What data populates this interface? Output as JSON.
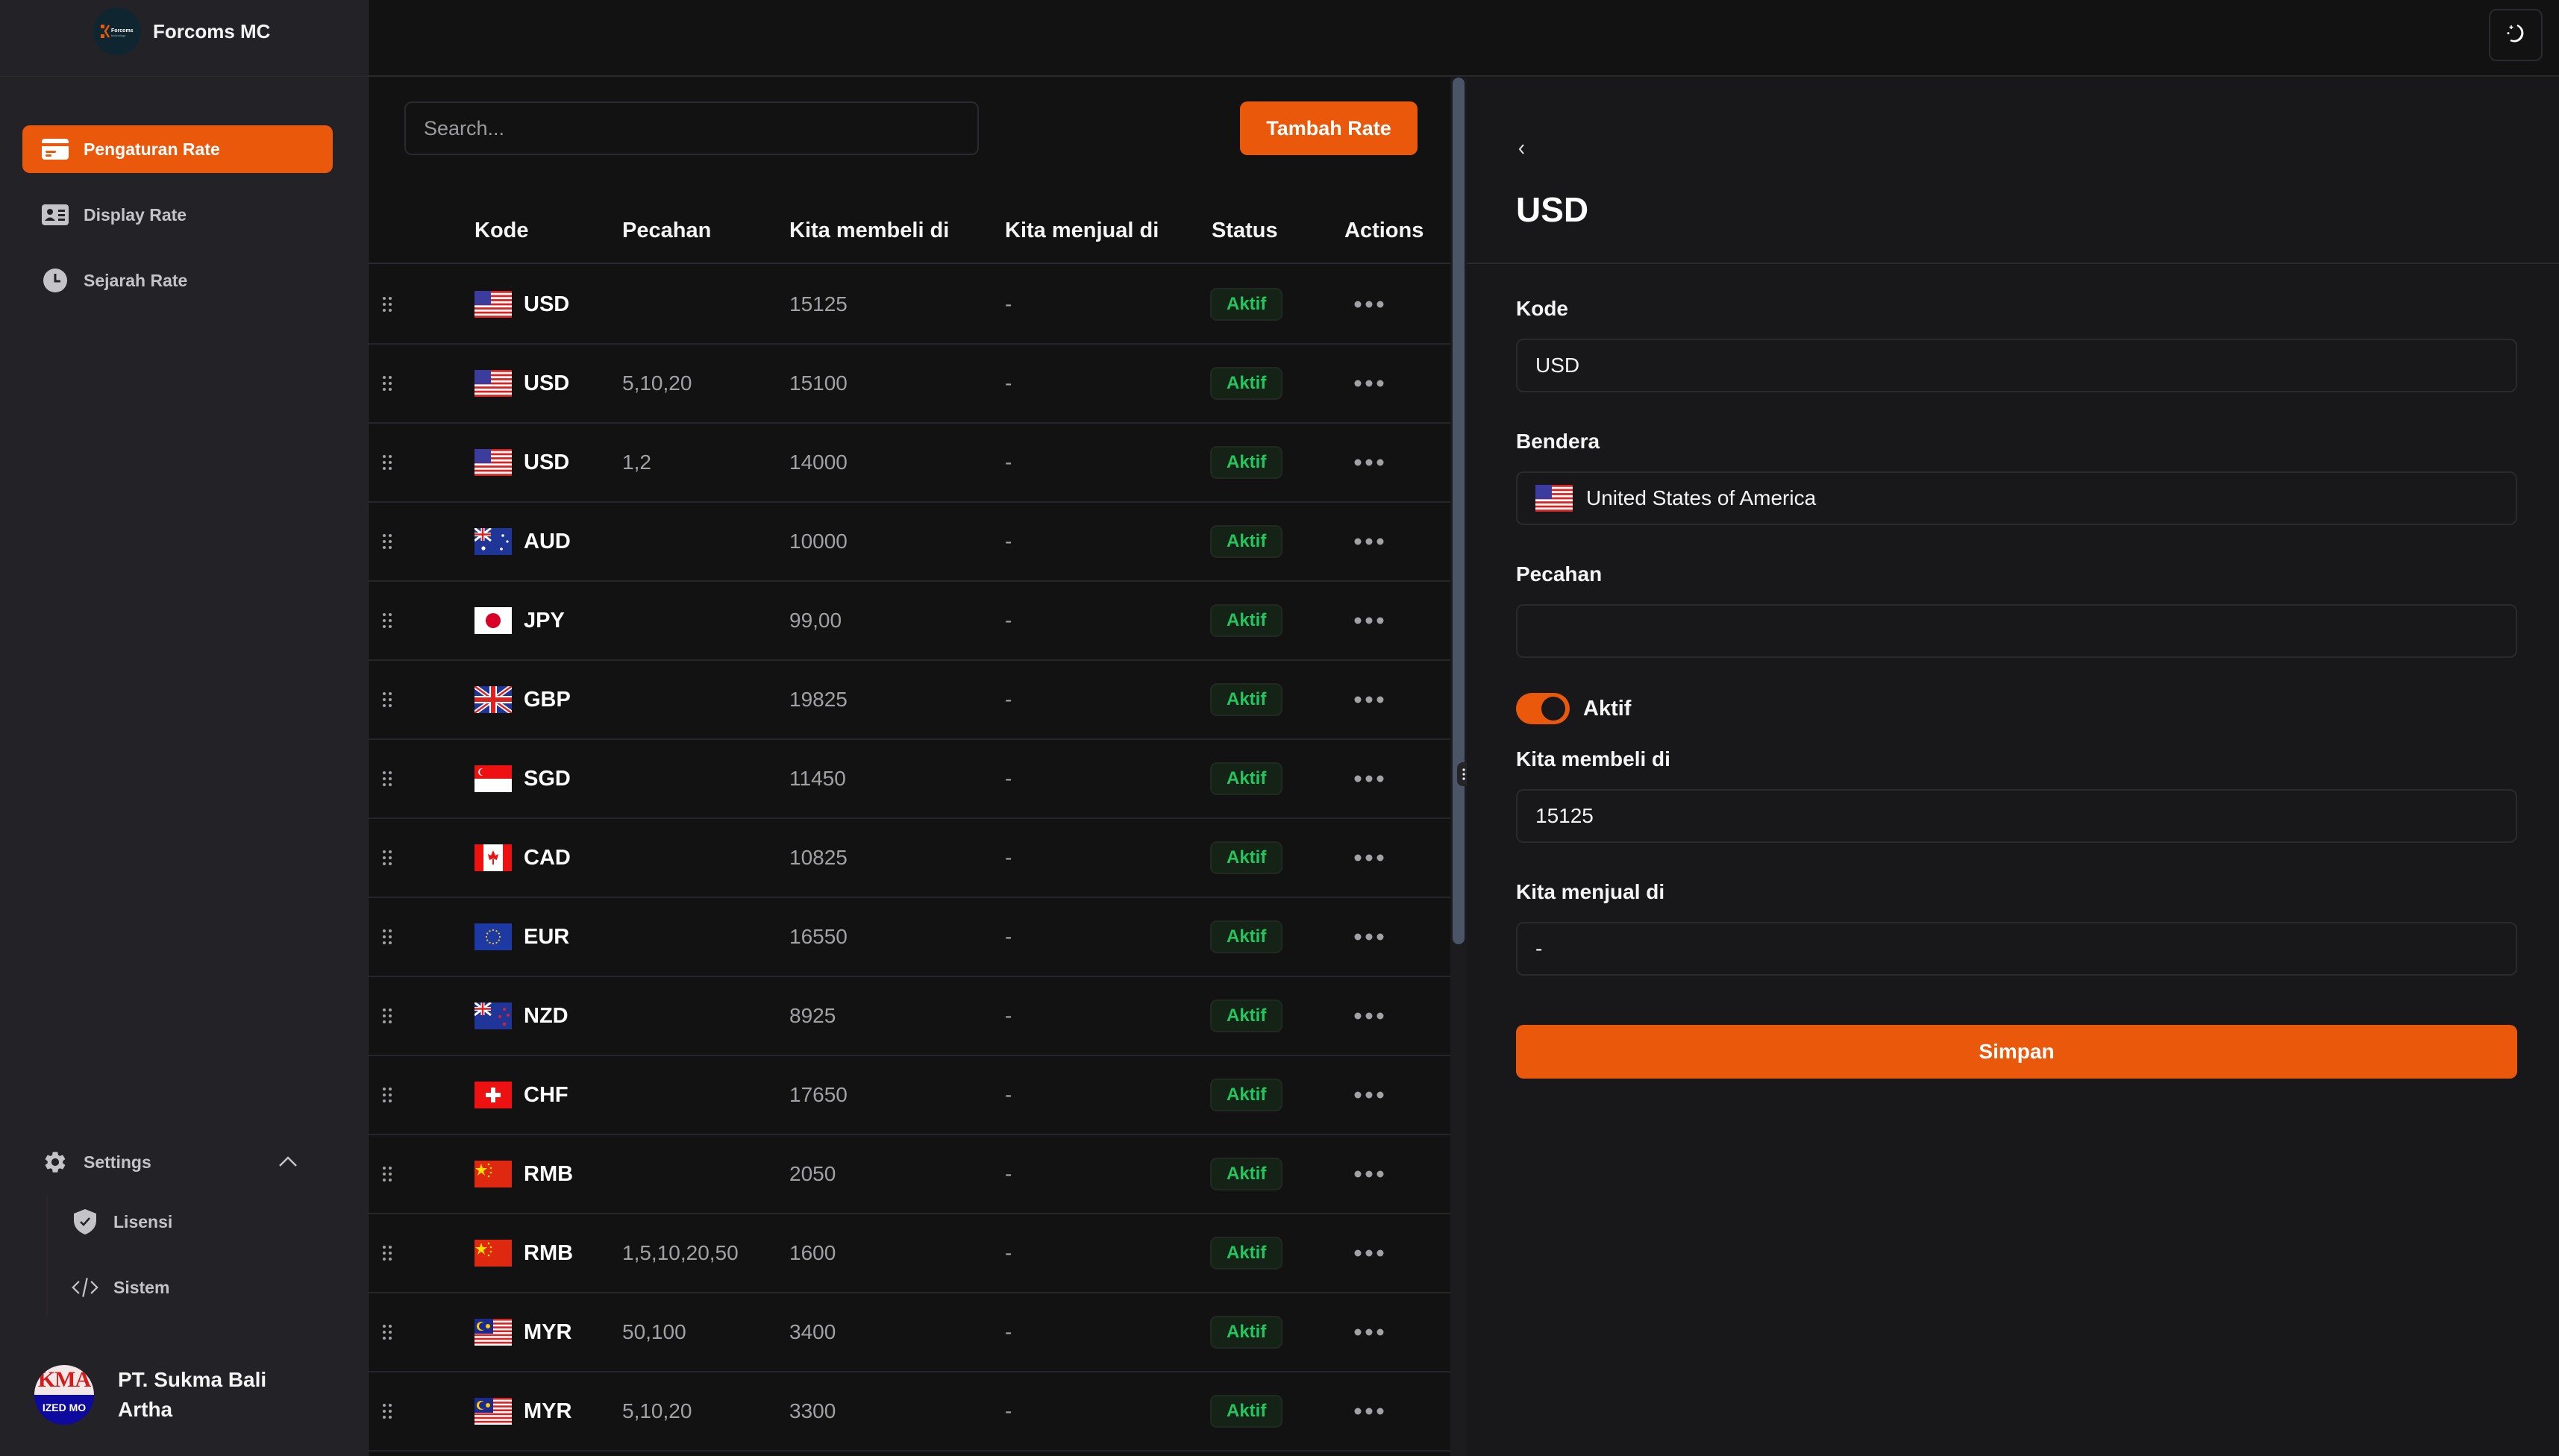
{
  "app": {
    "name": "Forcoms MC",
    "logo_text": "Forcoms"
  },
  "sidebar": {
    "items": [
      {
        "label": "Pengaturan Rate",
        "icon": "credit-card-icon",
        "active": true
      },
      {
        "label": "Display Rate",
        "icon": "id-card-icon",
        "active": false
      },
      {
        "label": "Sejarah Rate",
        "icon": "clock-icon",
        "active": false
      }
    ],
    "settings": {
      "label": "Settings",
      "icon": "gear-icon",
      "expanded": true,
      "items": [
        {
          "label": "Lisensi",
          "icon": "shield-check-icon"
        },
        {
          "label": "Sistem",
          "icon": "code-icon"
        }
      ]
    },
    "org": {
      "name": "PT. Sukma Bali Artha",
      "avatar_top": "KMA",
      "avatar_bottom": "IZED MO"
    }
  },
  "topbar": {
    "theme_icon": "moon-stars-icon"
  },
  "table": {
    "search_placeholder": "Search...",
    "add_label": "Tambah Rate",
    "headers": {
      "kode": "Kode",
      "pecahan": "Pecahan",
      "beli": "Kita membeli di",
      "jual": "Kita menjual di",
      "status": "Status",
      "actions": "Actions"
    },
    "rows": [
      {
        "kode": "USD",
        "flag": "us",
        "pecahan": "",
        "beli": "15125",
        "jual": "-",
        "status": "Aktif"
      },
      {
        "kode": "USD",
        "flag": "us",
        "pecahan": "5,10,20",
        "beli": "15100",
        "jual": "-",
        "status": "Aktif"
      },
      {
        "kode": "USD",
        "flag": "us",
        "pecahan": "1,2",
        "beli": "14000",
        "jual": "-",
        "status": "Aktif"
      },
      {
        "kode": "AUD",
        "flag": "au",
        "pecahan": "",
        "beli": "10000",
        "jual": "-",
        "status": "Aktif"
      },
      {
        "kode": "JPY",
        "flag": "jp",
        "pecahan": "",
        "beli": "99,00",
        "jual": "-",
        "status": "Aktif"
      },
      {
        "kode": "GBP",
        "flag": "gb",
        "pecahan": "",
        "beli": "19825",
        "jual": "-",
        "status": "Aktif"
      },
      {
        "kode": "SGD",
        "flag": "sg",
        "pecahan": "",
        "beli": "11450",
        "jual": "-",
        "status": "Aktif"
      },
      {
        "kode": "CAD",
        "flag": "ca",
        "pecahan": "",
        "beli": "10825",
        "jual": "-",
        "status": "Aktif"
      },
      {
        "kode": "EUR",
        "flag": "eu",
        "pecahan": "",
        "beli": "16550",
        "jual": "-",
        "status": "Aktif"
      },
      {
        "kode": "NZD",
        "flag": "nz",
        "pecahan": "",
        "beli": "8925",
        "jual": "-",
        "status": "Aktif"
      },
      {
        "kode": "CHF",
        "flag": "ch",
        "pecahan": "",
        "beli": "17650",
        "jual": "-",
        "status": "Aktif"
      },
      {
        "kode": "RMB",
        "flag": "cn",
        "pecahan": "",
        "beli": "2050",
        "jual": "-",
        "status": "Aktif"
      },
      {
        "kode": "RMB",
        "flag": "cn",
        "pecahan": "1,5,10,20,50",
        "beli": "1600",
        "jual": "-",
        "status": "Aktif"
      },
      {
        "kode": "MYR",
        "flag": "my",
        "pecahan": "50,100",
        "beli": "3400",
        "jual": "-",
        "status": "Aktif"
      },
      {
        "kode": "MYR",
        "flag": "my",
        "pecahan": "5,10,20",
        "beli": "3300",
        "jual": "-",
        "status": "Aktif"
      }
    ]
  },
  "detail": {
    "back_icon": "chevron-left-icon",
    "title": "USD",
    "fields": {
      "kode": {
        "label": "Kode",
        "value": "USD"
      },
      "bendera": {
        "label": "Bendera",
        "value": "United States of America",
        "flag": "us"
      },
      "pecahan": {
        "label": "Pecahan",
        "value": ""
      },
      "aktif": {
        "label": "Aktif",
        "on": true
      },
      "beli": {
        "label": "Kita membeli di",
        "value": "15125"
      },
      "jual": {
        "label": "Kita menjual di",
        "value": "-"
      }
    },
    "save_label": "Simpan"
  },
  "colors": {
    "accent": "#ea580c",
    "status_green": "#22c55e",
    "sidebar_bg": "#222227",
    "panel_bg": "#18181b",
    "table_bg": "#121212"
  }
}
